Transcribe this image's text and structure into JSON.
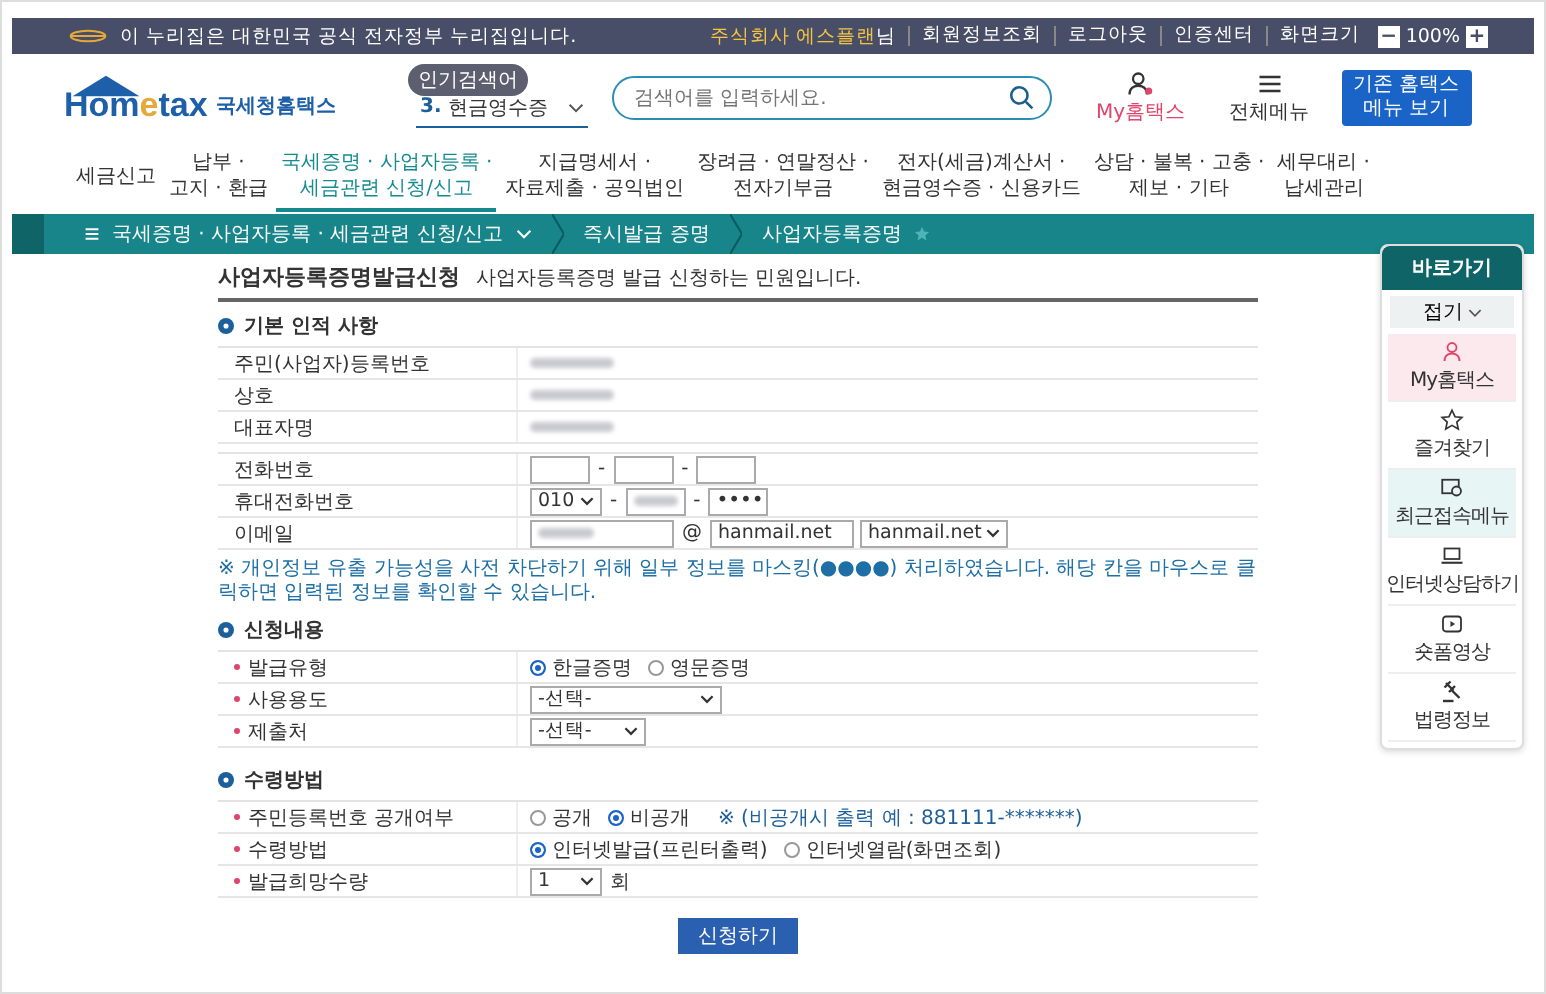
{
  "top_bar": {
    "notice": "이 누리집은 대한민국 공식 전자정부 누리집입니다.",
    "user": "주식회사 에스플랜",
    "honorific": "님",
    "links": [
      "회원정보조회",
      "로그아웃",
      "인증센터",
      "화면크기"
    ],
    "zoom": "100%",
    "zoom_out": "−",
    "zoom_in": "+"
  },
  "header": {
    "logo": "Hom",
    "logo_e": "e",
    "logo_tail": "tax",
    "site_name": "국세청홈택스",
    "popular_badge": "인기검색어",
    "popular_rank": "3.",
    "popular_term": "현금영수증",
    "search": {
      "placeholder": "검색어를 입력하세요."
    },
    "my_label": "My홈택스",
    "menu_label": "전체메뉴",
    "classic_button": [
      "기존 홈택스",
      "메뉴 보기"
    ]
  },
  "nav": [
    {
      "lines": [
        "세금신고"
      ],
      "selected": false
    },
    {
      "lines": [
        "납부 ·",
        "고지 · 환급"
      ],
      "selected": false
    },
    {
      "lines": [
        "국세증명 · 사업자등록 ·",
        "세금관련 신청/신고"
      ],
      "selected": true
    },
    {
      "lines": [
        "지급명세서 ·",
        "자료제출 · 공익법인"
      ],
      "selected": false
    },
    {
      "lines": [
        "장려금 · 연말정산 ·",
        "전자기부금"
      ],
      "selected": false
    },
    {
      "lines": [
        "전자(세금)계산서 ·",
        "현금영수증 · 신용카드"
      ],
      "selected": false
    },
    {
      "lines": [
        "상담 · 불복 · 고충 ·",
        "제보 · 기타"
      ],
      "selected": false
    },
    {
      "lines": [
        "세무대리 ·",
        "납세관리"
      ],
      "selected": false
    }
  ],
  "breadcrumb": [
    "국세증명 · 사업자등록 · 세금관련 신청/신고",
    "즉시발급 증명",
    "사업자등록증명"
  ],
  "quick": {
    "title": "바로가기",
    "fold": "접기",
    "items": [
      {
        "label": "My홈택스",
        "color": "#fbe9ee"
      },
      {
        "label": "즐겨찾기",
        "color": "#ffffff"
      },
      {
        "label": "최근접속메뉴",
        "color": "#e8f5f5"
      },
      {
        "label": "인터넷상담하기",
        "color": "#ffffff"
      },
      {
        "label": "숏폼영상",
        "color": "#ffffff"
      },
      {
        "label": "법령정보",
        "color": "#ffffff"
      }
    ]
  },
  "form": {
    "title": "사업자등록증명발급신청",
    "subtitle": "사업자등록증명 발급 신청하는 민원입니다.",
    "sections": [
      {
        "heading": "기본 인적 사항",
        "groups": [
          [
            {
              "label": "주민(사업자)등록번호",
              "kind": "blurred"
            },
            {
              "label": "상호",
              "kind": "blurred"
            },
            {
              "label": "대표자명",
              "kind": "blurred"
            }
          ],
          [
            {
              "label": "전화번호",
              "kind": "phone",
              "separator": "-"
            },
            {
              "label": "휴대전화번호",
              "kind": "mobile",
              "prefix": "010",
              "separator": "-",
              "last": "••••"
            },
            {
              "label": "이메일",
              "kind": "email",
              "at": "@",
              "domain": "hanmail.net",
              "domain_select": "hanmail.net"
            }
          ]
        ],
        "notice": "※ 개인정보 유출 가능성을 사전 차단하기 위해 일부 정보를 마스킹(●●●●) 처리하였습니다. 해당 칸을 마우스로 클릭하면 입력된 정보를 확인할 수 있습니다."
      },
      {
        "heading": "신청내용",
        "groups": [
          [
            {
              "label": "발급유형",
              "kind": "radio",
              "required": true,
              "options": [
                {
                  "label": "한글증명",
                  "selected": true
                },
                {
                  "label": "영문증명",
                  "selected": false
                }
              ]
            },
            {
              "label": "사용용도",
              "kind": "select",
              "required": true,
              "value": "-선택-",
              "wide": true
            },
            {
              "label": "제출처",
              "kind": "select",
              "required": true,
              "value": "-선택-",
              "wide": false
            }
          ]
        ]
      },
      {
        "heading": "수령방법",
        "groups": [
          [
            {
              "label": "주민등록번호 공개여부",
              "kind": "radio",
              "required": true,
              "options": [
                {
                  "label": "공개",
                  "selected": false
                },
                {
                  "label": "비공개",
                  "selected": true
                }
              ],
              "note": "※ (비공개시 출력 예 : 881111-*******)"
            },
            {
              "label": "수령방법",
              "kind": "radio",
              "required": true,
              "options": [
                {
                  "label": "인터넷발급(프린터출력)",
                  "selected": true
                },
                {
                  "label": "인터넷열람(화면조회)",
                  "selected": false
                }
              ]
            },
            {
              "label": "발급희망수량",
              "kind": "count",
              "required": true,
              "value": "1",
              "unit": "회"
            }
          ]
        ]
      }
    ],
    "submit": "신청하기"
  }
}
